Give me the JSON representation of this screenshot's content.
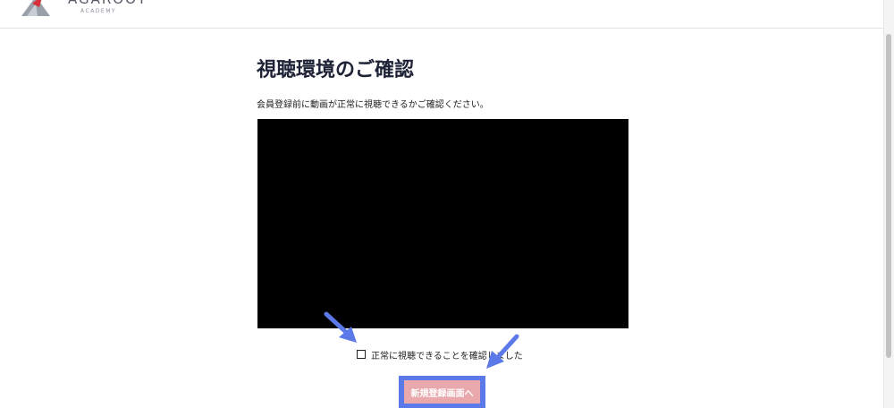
{
  "header": {
    "logo_text": "AGAROOT",
    "logo_sub": "ACADEMY"
  },
  "main": {
    "title": "視聴環境のご確認",
    "intro": "会員登録前に動画が正常に視聴できるかご確認ください。",
    "confirm_label": "正常に視聴できることを確認しました",
    "register_button": "新規登録画面へ"
  },
  "colors": {
    "annotation_arrow": "#5b79e8",
    "button_bg": "#e8a8ac",
    "video_bg": "#000000"
  },
  "icons": {
    "logo": "agaroot-logo-icon",
    "arrow_checkbox": "arrow-down-right-icon",
    "arrow_button": "arrow-down-left-icon"
  }
}
